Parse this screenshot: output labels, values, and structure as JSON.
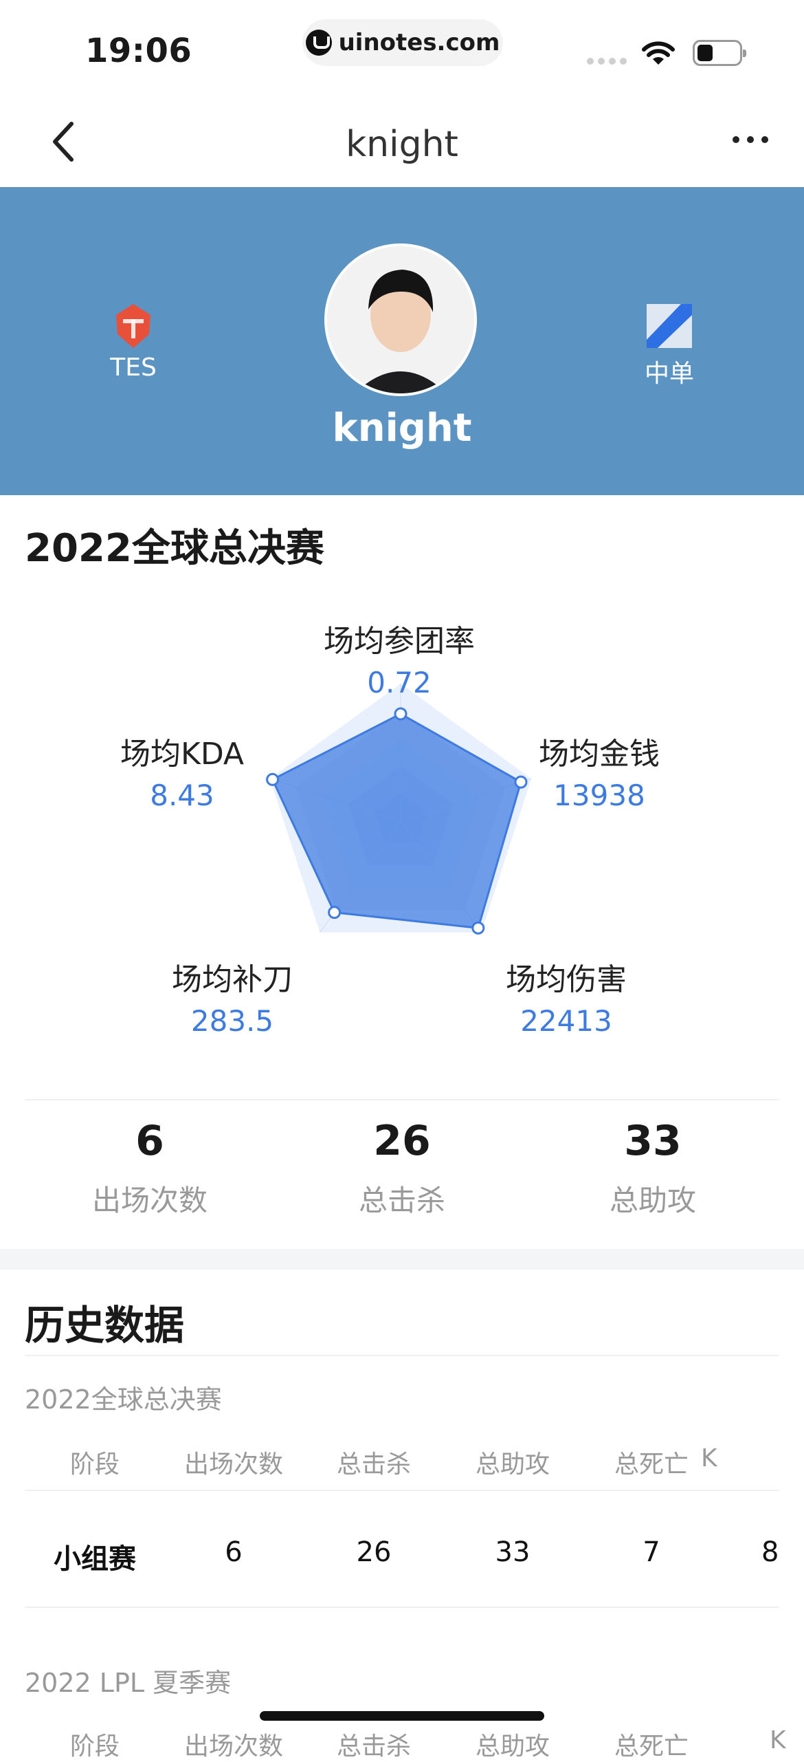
{
  "status": {
    "time": "19:06",
    "url": "uinotes.com"
  },
  "nav": {
    "title": "knight"
  },
  "profile": {
    "team": "TES",
    "role": "中单",
    "name": "knight",
    "colors": {
      "banner": "#5b93c3",
      "team_logo": "#e8503a",
      "accent": "#3e7be0"
    }
  },
  "season": {
    "title": "2022全球总决赛",
    "radar": [
      {
        "label": "场均参团率",
        "value": "0.72",
        "level": 0.78
      },
      {
        "label": "场均金钱",
        "value": "13938",
        "level": 0.92
      },
      {
        "label": "场均伤害",
        "value": "22413",
        "level": 0.96
      },
      {
        "label": "场均补刀",
        "value": "283.5",
        "level": 0.82
      },
      {
        "label": "场均KDA",
        "value": "8.43",
        "level": 0.98
      }
    ],
    "stats": [
      {
        "value": "6",
        "label": "出场次数"
      },
      {
        "value": "26",
        "label": "总击杀"
      },
      {
        "value": "33",
        "label": "总助攻"
      }
    ]
  },
  "history": {
    "title": "历史数据",
    "tables": [
      {
        "name": "2022全球总决赛",
        "headers": [
          "阶段",
          "出场次数",
          "总击杀",
          "总助攻",
          "总死亡",
          "K"
        ],
        "rows": [
          [
            "小组赛",
            "6",
            "26",
            "33",
            "7",
            "8"
          ]
        ]
      },
      {
        "name": "2022 LPL 夏季赛",
        "headers": [
          "阶段",
          "出场次数",
          "总击杀",
          "总助攻",
          "总死亡",
          "K"
        ],
        "rows": []
      }
    ]
  }
}
